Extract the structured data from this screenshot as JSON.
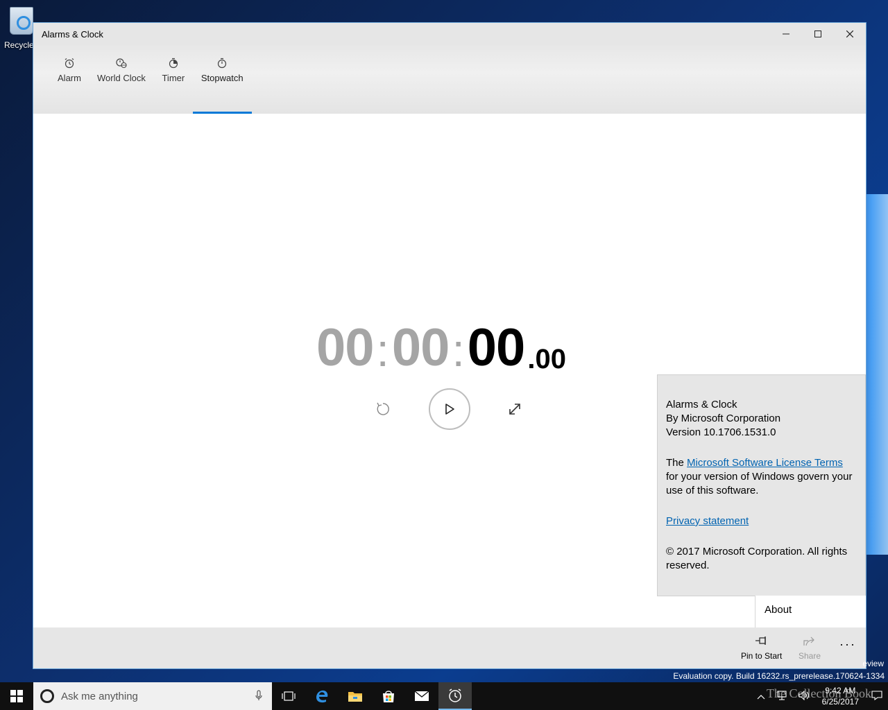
{
  "desktop": {
    "recycle_bin_label": "Recycle",
    "watermark_line1": "eview",
    "watermark_line2": "Evaluation copy. Build 16232.rs_prerelease.170624-1334",
    "brand_watermark": "The Collection Book"
  },
  "window": {
    "title": "Alarms & Clock",
    "controls": {
      "minimize": "—",
      "maximize": "☐",
      "close": "✕"
    }
  },
  "tabs": [
    {
      "label": "Alarm",
      "icon": "alarm-icon"
    },
    {
      "label": "World Clock",
      "icon": "world-clock-icon"
    },
    {
      "label": "Timer",
      "icon": "timer-icon"
    },
    {
      "label": "Stopwatch",
      "icon": "stopwatch-icon",
      "active": true
    }
  ],
  "stopwatch": {
    "hours": "00",
    "minutes": "00",
    "seconds": "00",
    "fraction": ".00",
    "sep": ":"
  },
  "about": {
    "app_name": "Alarms & Clock",
    "publisher": "By Microsoft Corporation",
    "version": "Version 10.1706.1531.0",
    "license_prefix": "The ",
    "license_link": "Microsoft Software License Terms",
    "license_suffix": " for your version of Windows govern your use of this software.",
    "privacy_link": "Privacy statement",
    "copyright": "© 2017 Microsoft Corporation. All rights reserved.",
    "menu_item": "About"
  },
  "appbar": {
    "pin_label": "Pin to Start",
    "share_label": "Share",
    "more": "···"
  },
  "taskbar": {
    "search_placeholder": "Ask me anything",
    "time": "9:42 AM",
    "date": "6/25/2017"
  },
  "colors": {
    "accent": "#0078d7",
    "link": "#0063b1",
    "dim_digits": "#a5a5a5"
  }
}
